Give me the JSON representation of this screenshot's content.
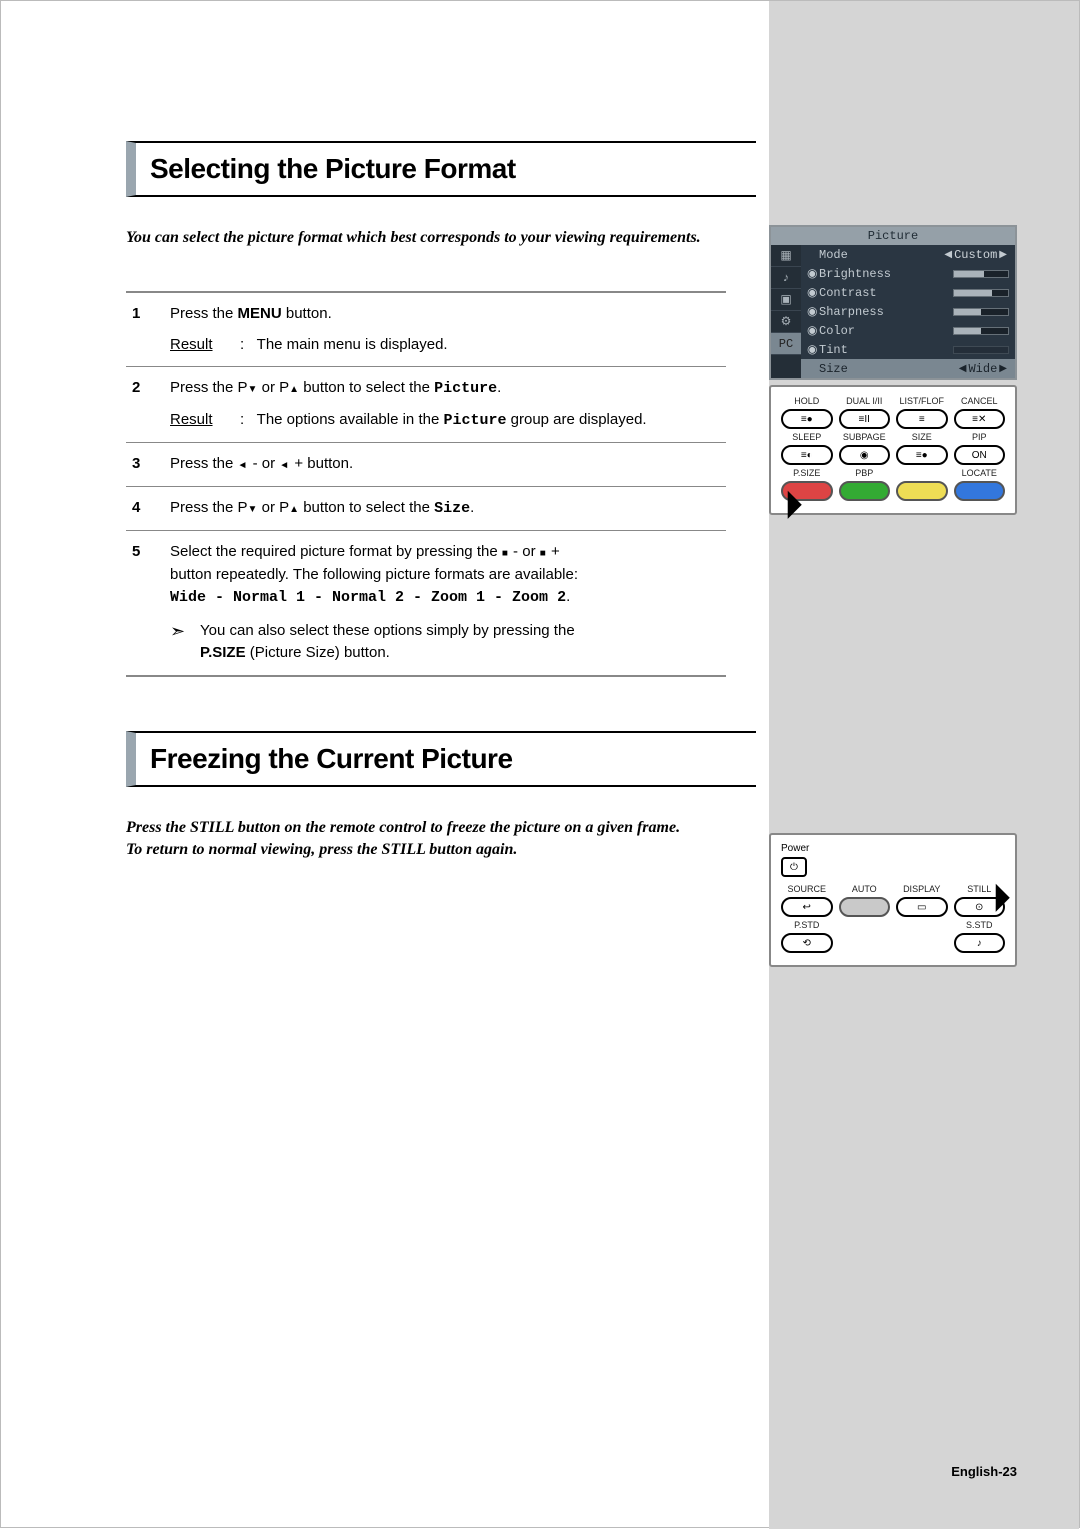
{
  "section1": {
    "title": "Selecting the Picture Format",
    "intro": "You can select the picture format which best corresponds to your viewing requirements.",
    "steps": [
      {
        "num": "1",
        "text_pre": "Press the ",
        "bold1": "MENU",
        "text_post": " button.",
        "result_label": "Result",
        "result_text": "The main menu is displayed."
      },
      {
        "num": "2",
        "text_pre": "Press the P",
        "text_mid": " or P",
        "text_post": " button to select the ",
        "mono": "Picture",
        "text_end": ".",
        "result_label": "Result",
        "result_pre": "The options available in the ",
        "result_mono": "Picture",
        "result_post": " group are displayed."
      },
      {
        "num": "3",
        "text_pre": "Press the ",
        "text_mid": " - or ",
        "text_post": " + button."
      },
      {
        "num": "4",
        "text_pre": "Press the P",
        "text_mid": " or P",
        "text_post": " button to select the ",
        "mono": "Size",
        "text_end": "."
      },
      {
        "num": "5",
        "line1_pre": "Select the required picture format by pressing the ",
        "line1_mid": " - or ",
        "line1_post": " +",
        "line2": "button repeatedly. The following picture formats are available:",
        "formats": "Wide - Normal 1 - Normal 2 - Zoom 1 - Zoom 2",
        "formats_end": ".",
        "note_pre": "You can also select these options simply by pressing the",
        "note_bold": "P.SIZE",
        "note_post": " (Picture Size) button."
      }
    ]
  },
  "section2": {
    "title": "Freezing the Current Picture",
    "intro1": "Press the STILL button on the remote control to freeze the picture on a given frame.",
    "intro2": "To return to normal viewing, press the STILL button again."
  },
  "osd": {
    "title": "Picture",
    "rows": [
      {
        "label": "Mode",
        "value": "Custom",
        "type": "select"
      },
      {
        "label": "Brightness",
        "type": "bar",
        "fill": 56
      },
      {
        "label": "Contrast",
        "type": "bar",
        "fill": 70
      },
      {
        "label": "Sharpness",
        "type": "bar",
        "fill": 50
      },
      {
        "label": "Color",
        "type": "bar",
        "fill": 50
      },
      {
        "label": "Tint",
        "type": "bar",
        "fill": 0,
        "dim": true
      },
      {
        "label": "Size",
        "value": "Wide",
        "type": "select",
        "selected": true
      }
    ]
  },
  "remote1": {
    "row1_labels": [
      "HOLD",
      "DUAL I/II",
      "LIST/FLOF",
      "CANCEL"
    ],
    "row1_icons": [
      "≡●",
      "≡II",
      "≡",
      "≡✕"
    ],
    "row2_labels": [
      "SLEEP",
      "SUBPAGE",
      "SIZE",
      "PIP"
    ],
    "row2_icons": [
      "≡◐",
      "◉",
      "≡●",
      "ON"
    ],
    "row3_labels": [
      "P.SIZE",
      "PBP",
      "",
      "LOCATE"
    ],
    "row3_colors": [
      "red",
      "green",
      "yellow",
      "blue"
    ]
  },
  "remote2": {
    "power": "Power",
    "labels": [
      "SOURCE",
      "AUTO",
      "DISPLAY",
      "STILL"
    ],
    "icons": [
      "↩",
      "",
      "▭",
      "⊙"
    ],
    "bottom_labels": [
      "P.STD",
      "",
      "",
      "S.STD"
    ],
    "bottom_icons": [
      "⟲",
      "",
      "",
      "♪"
    ]
  },
  "page_number": "English-23"
}
